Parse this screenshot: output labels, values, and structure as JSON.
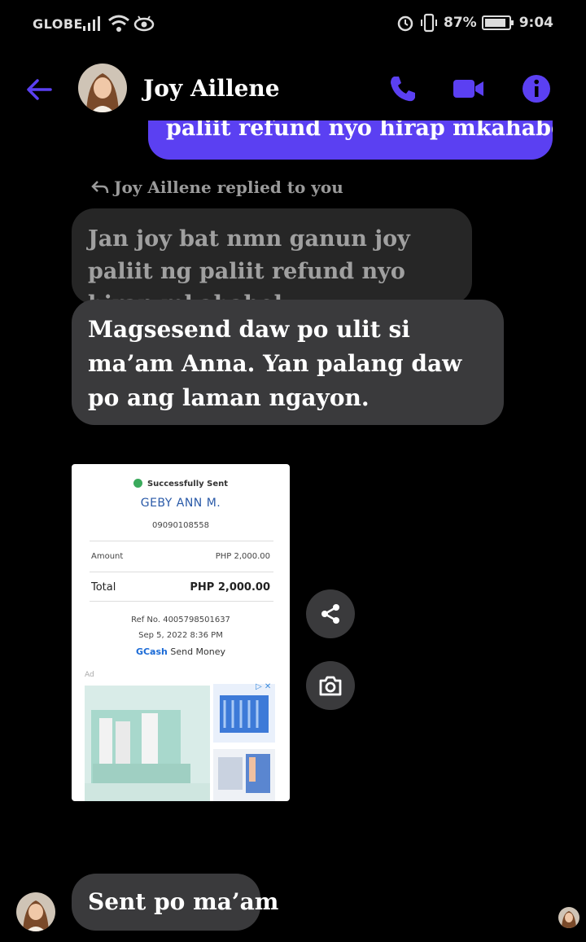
{
  "status_bar": {
    "carrier": "GLOBE",
    "battery": "87%",
    "time": "9:04",
    "icons": [
      "signal-icon",
      "wifi-icon",
      "eye-icon",
      "alarm-icon",
      "vibrate-icon",
      "battery-icon"
    ]
  },
  "header": {
    "contact_name": "Joy Aillene",
    "icons": [
      "back-arrow-icon",
      "phone-icon",
      "video-icon",
      "info-icon"
    ],
    "accent": "#5b40f2"
  },
  "messages": {
    "sent_partial": "paliit refund nyo hirap mkahabol",
    "reply_note": "Joy Aillene replied to you",
    "quoted_text": "Jan joy bat nmn ganun joy paliit ng paliit refund nyo hirap mkahabol",
    "reply_text": "Magsesend daw po ulit si ma’am Anna. Yan palang daw po ang laman ngayon.",
    "last_text": "Sent po ma’am"
  },
  "receipt": {
    "status": "Successfully Sent",
    "name": "GEBY ANN M.",
    "phone": "09090108558",
    "amount_label": "Amount",
    "amount_value": "PHP 2,000.00",
    "total_label": "Total",
    "total_value": "PHP 2,000.00",
    "ref": "Ref No. 4005798501637",
    "date": "Sep 5, 2022 8:36 PM",
    "method_brand": "GCash",
    "method_text": " Send Money",
    "ad_label": "Ad"
  },
  "actions": [
    "share-icon",
    "camera-icon"
  ]
}
